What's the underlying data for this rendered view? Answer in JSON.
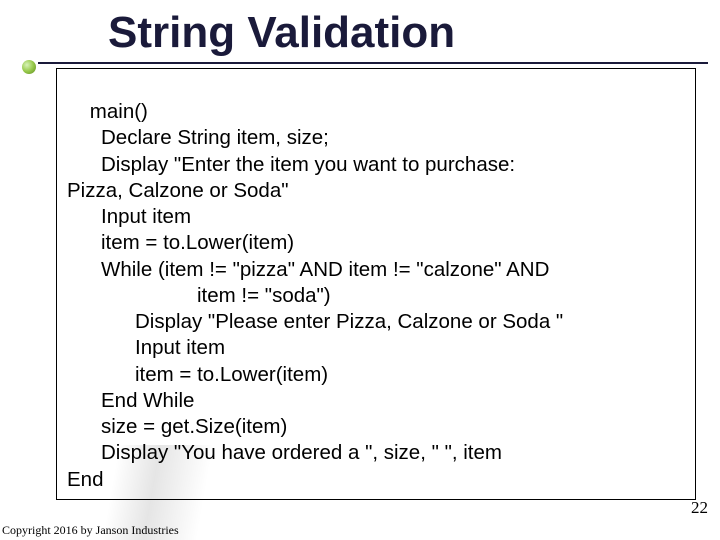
{
  "title": "String Validation",
  "code": {
    "l1": "main()",
    "l2": "Declare String item, size;",
    "l3": "Display \"Enter the item you want to purchase:",
    "l4": "Pizza, Calzone or Soda\"",
    "l5": "Input item",
    "l6": "item = to.Lower(item)",
    "l7": "While (item != \"pizza\" AND item != \"calzone\" AND",
    "l8": "item != \"soda\")",
    "l9": "Display \"Please enter Pizza, Calzone or Soda \"",
    "l10": "Input item",
    "l11": "item = to.Lower(item)",
    "l12": "End While",
    "l13": "size = get.Size(item)",
    "l14": "Display \"You have ordered a \", size, \" \", item",
    "l15": "End"
  },
  "page_number": "22",
  "copyright": "Copyright 2016 by Janson Industries"
}
